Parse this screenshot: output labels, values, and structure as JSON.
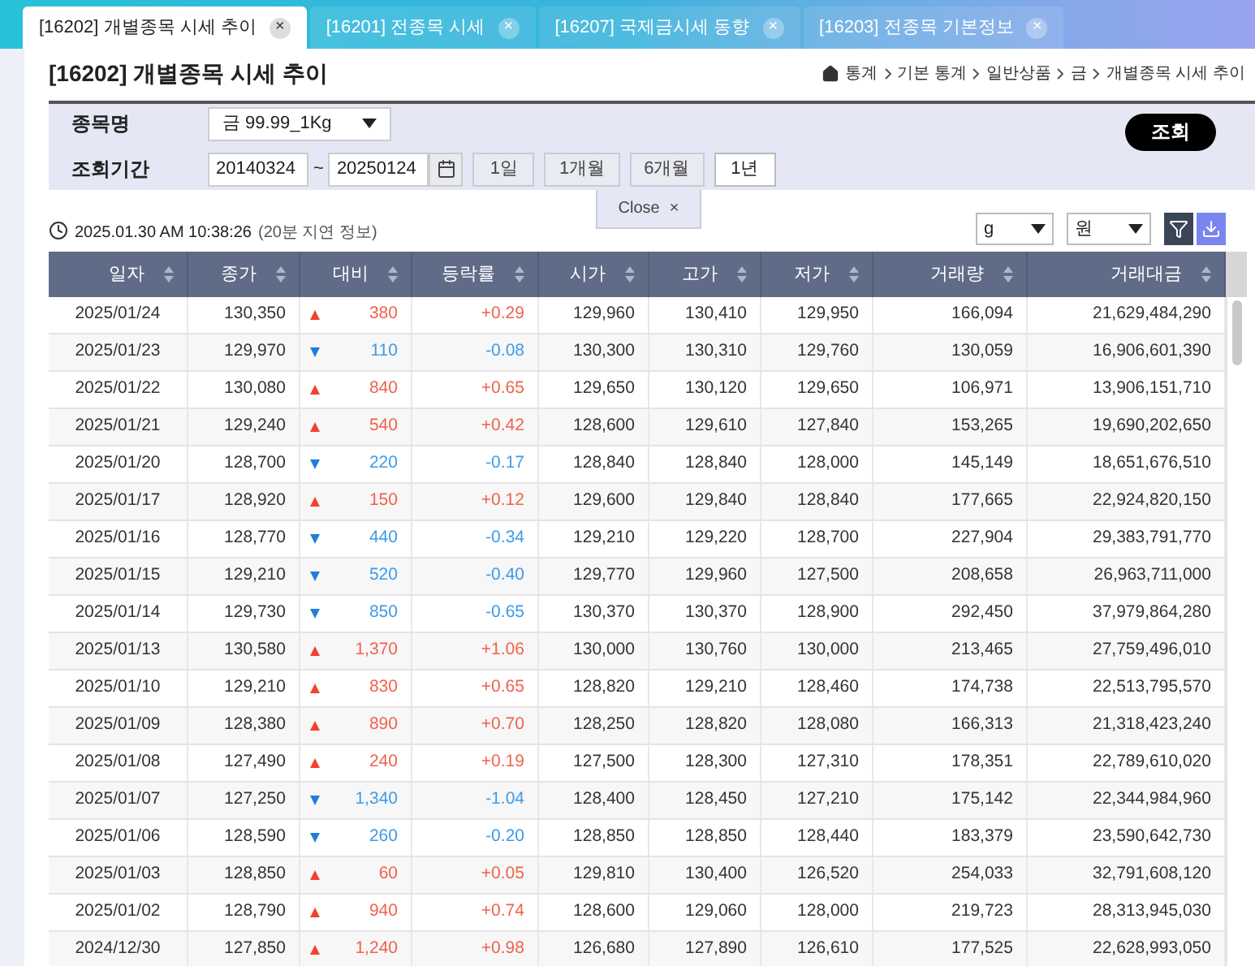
{
  "tabs": [
    {
      "label": "[16202] 개별종목 시세 추이",
      "selected": true,
      "close": "×"
    },
    {
      "label": "[16201] 전종목 시세",
      "selected": false,
      "close": "×"
    },
    {
      "label": "[16207] 국제금시세 동향",
      "selected": false,
      "close": "×"
    },
    {
      "label": "[16203] 전종목 기본정보",
      "selected": false,
      "close": "×"
    }
  ],
  "page_title": "[16202] 개별종목 시세 추이",
  "breadcrumb": [
    "통계",
    "기본 통계",
    "일반상품",
    "금",
    "개별종목 시세 추이"
  ],
  "filters": {
    "item_label": "종목명",
    "item_value": "금 99.99_1Kg",
    "period_label": "조회기간",
    "start_date": "20140324",
    "separator": "~",
    "end_date": "20250124",
    "ranges": [
      {
        "label": "1일",
        "selected": false
      },
      {
        "label": "1개월",
        "selected": false
      },
      {
        "label": "6개월",
        "selected": false
      },
      {
        "label": "1년",
        "selected": true
      }
    ],
    "search_button": "조회",
    "close_tab": "Close",
    "close_icon": "×"
  },
  "timestamp": "2025.01.30 AM 10:38:26",
  "delay_note": "(20분 지연 정보)",
  "unit_select": "g",
  "currency_select": "원",
  "table": {
    "columns": [
      "일자",
      "종가",
      "대비",
      "등락률",
      "시가",
      "고가",
      "저가",
      "거래량",
      "거래대금"
    ],
    "rows": [
      {
        "kind": "up",
        "cells": [
          "2025/01/24",
          "130,350",
          "380",
          "+0.29",
          "129,960",
          "130,410",
          "129,950",
          "166,094",
          "21,629,484,290"
        ]
      },
      {
        "kind": "down",
        "cells": [
          "2025/01/23",
          "129,970",
          "110",
          "-0.08",
          "130,300",
          "130,310",
          "129,760",
          "130,059",
          "16,906,601,390"
        ]
      },
      {
        "kind": "up",
        "cells": [
          "2025/01/22",
          "130,080",
          "840",
          "+0.65",
          "129,650",
          "130,120",
          "129,650",
          "106,971",
          "13,906,151,710"
        ]
      },
      {
        "kind": "up",
        "cells": [
          "2025/01/21",
          "129,240",
          "540",
          "+0.42",
          "128,600",
          "129,610",
          "127,840",
          "153,265",
          "19,690,202,650"
        ]
      },
      {
        "kind": "down",
        "cells": [
          "2025/01/20",
          "128,700",
          "220",
          "-0.17",
          "128,840",
          "128,840",
          "128,000",
          "145,149",
          "18,651,676,510"
        ]
      },
      {
        "kind": "up",
        "cells": [
          "2025/01/17",
          "128,920",
          "150",
          "+0.12",
          "129,600",
          "129,840",
          "128,840",
          "177,665",
          "22,924,820,150"
        ]
      },
      {
        "kind": "down",
        "cells": [
          "2025/01/16",
          "128,770",
          "440",
          "-0.34",
          "129,210",
          "129,220",
          "128,700",
          "227,904",
          "29,383,791,770"
        ]
      },
      {
        "kind": "down",
        "cells": [
          "2025/01/15",
          "129,210",
          "520",
          "-0.40",
          "129,770",
          "129,960",
          "127,500",
          "208,658",
          "26,963,711,000"
        ]
      },
      {
        "kind": "down",
        "cells": [
          "2025/01/14",
          "129,730",
          "850",
          "-0.65",
          "130,370",
          "130,370",
          "128,900",
          "292,450",
          "37,979,864,280"
        ]
      },
      {
        "kind": "up",
        "cells": [
          "2025/01/13",
          "130,580",
          "1,370",
          "+1.06",
          "130,000",
          "130,760",
          "130,000",
          "213,465",
          "27,759,496,010"
        ]
      },
      {
        "kind": "up",
        "cells": [
          "2025/01/10",
          "129,210",
          "830",
          "+0.65",
          "128,820",
          "129,210",
          "128,460",
          "174,738",
          "22,513,795,570"
        ]
      },
      {
        "kind": "up",
        "cells": [
          "2025/01/09",
          "128,380",
          "890",
          "+0.70",
          "128,250",
          "128,820",
          "128,080",
          "166,313",
          "21,318,423,240"
        ]
      },
      {
        "kind": "up",
        "cells": [
          "2025/01/08",
          "127,490",
          "240",
          "+0.19",
          "127,500",
          "128,300",
          "127,310",
          "178,351",
          "22,789,610,020"
        ]
      },
      {
        "kind": "down",
        "cells": [
          "2025/01/07",
          "127,250",
          "1,340",
          "-1.04",
          "128,400",
          "128,450",
          "127,210",
          "175,142",
          "22,344,984,960"
        ]
      },
      {
        "kind": "down",
        "cells": [
          "2025/01/06",
          "128,590",
          "260",
          "-0.20",
          "128,850",
          "128,850",
          "128,440",
          "183,379",
          "23,590,642,730"
        ]
      },
      {
        "kind": "up",
        "cells": [
          "2025/01/03",
          "128,850",
          "60",
          "+0.05",
          "129,810",
          "130,400",
          "126,520",
          "254,033",
          "32,791,608,120"
        ]
      },
      {
        "kind": "up",
        "cells": [
          "2025/01/02",
          "128,790",
          "940",
          "+0.74",
          "128,600",
          "129,060",
          "128,000",
          "219,723",
          "28,313,945,030"
        ]
      },
      {
        "kind": "up",
        "cells": [
          "2024/12/30",
          "127,850",
          "1,240",
          "+0.98",
          "126,680",
          "127,890",
          "126,610",
          "177,525",
          "22,628,993,050"
        ]
      }
    ]
  }
}
